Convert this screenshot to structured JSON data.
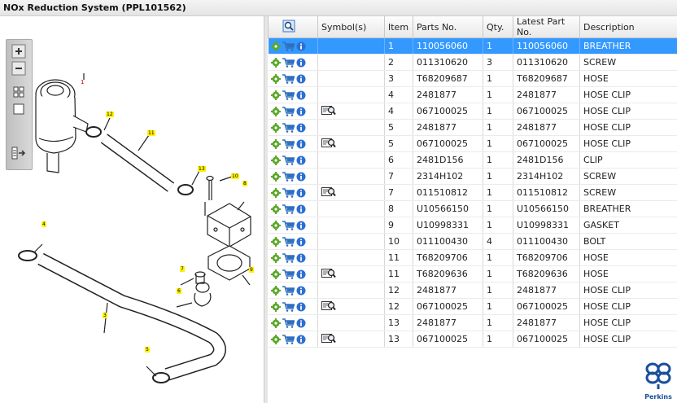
{
  "title": "NOx Reduction System (PPL101562)",
  "columns": [
    "",
    "Symbol(s)",
    "Item",
    "Parts No.",
    "Qty.",
    "Latest Part No.",
    "Description"
  ],
  "rows": [
    {
      "symbol": false,
      "item": "1",
      "part_no": "110056060",
      "qty": "1",
      "latest": "110056060",
      "desc": "BREATHER",
      "selected": true
    },
    {
      "symbol": false,
      "item": "2",
      "part_no": "011310620",
      "qty": "3",
      "latest": "011310620",
      "desc": "SCREW"
    },
    {
      "symbol": false,
      "item": "3",
      "part_no": "T68209687",
      "qty": "1",
      "latest": "T68209687",
      "desc": "HOSE"
    },
    {
      "symbol": false,
      "item": "4",
      "part_no": "2481877",
      "qty": "1",
      "latest": "2481877",
      "desc": "HOSE CLIP"
    },
    {
      "symbol": true,
      "item": "4",
      "part_no": "067100025",
      "qty": "1",
      "latest": "067100025",
      "desc": "HOSE CLIP"
    },
    {
      "symbol": false,
      "item": "5",
      "part_no": "2481877",
      "qty": "1",
      "latest": "2481877",
      "desc": "HOSE CLIP"
    },
    {
      "symbol": true,
      "item": "5",
      "part_no": "067100025",
      "qty": "1",
      "latest": "067100025",
      "desc": "HOSE CLIP"
    },
    {
      "symbol": false,
      "item": "6",
      "part_no": "2481D156",
      "qty": "1",
      "latest": "2481D156",
      "desc": "CLIP"
    },
    {
      "symbol": false,
      "item": "7",
      "part_no": "2314H102",
      "qty": "1",
      "latest": "2314H102",
      "desc": "SCREW"
    },
    {
      "symbol": true,
      "item": "7",
      "part_no": "011510812",
      "qty": "1",
      "latest": "011510812",
      "desc": "SCREW"
    },
    {
      "symbol": false,
      "item": "8",
      "part_no": "U10566150",
      "qty": "1",
      "latest": "U10566150",
      "desc": "BREATHER"
    },
    {
      "symbol": false,
      "item": "9",
      "part_no": "U10998331",
      "qty": "1",
      "latest": "U10998331",
      "desc": "GASKET"
    },
    {
      "symbol": false,
      "item": "10",
      "part_no": "011100430",
      "qty": "4",
      "latest": "011100430",
      "desc": "BOLT"
    },
    {
      "symbol": false,
      "item": "11",
      "part_no": "T68209706",
      "qty": "1",
      "latest": "T68209706",
      "desc": "HOSE"
    },
    {
      "symbol": true,
      "item": "11",
      "part_no": "T68209636",
      "qty": "1",
      "latest": "T68209636",
      "desc": "HOSE"
    },
    {
      "symbol": false,
      "item": "12",
      "part_no": "2481877",
      "qty": "1",
      "latest": "2481877",
      "desc": "HOSE CLIP"
    },
    {
      "symbol": true,
      "item": "12",
      "part_no": "067100025",
      "qty": "1",
      "latest": "067100025",
      "desc": "HOSE CLIP"
    },
    {
      "symbol": false,
      "item": "13",
      "part_no": "2481877",
      "qty": "1",
      "latest": "2481877",
      "desc": "HOSE CLIP"
    },
    {
      "symbol": true,
      "item": "13",
      "part_no": "067100025",
      "qty": "1",
      "latest": "067100025",
      "desc": "HOSE CLIP"
    }
  ],
  "callouts": [
    "1",
    "12",
    "11",
    "13",
    "10",
    "8",
    "4",
    "7",
    "9",
    "6",
    "3",
    "5"
  ],
  "brand": {
    "name": "Perkins",
    "color": "#1a4f9c"
  },
  "colors": {
    "selection": "#3399ff",
    "callout": "#fff200",
    "gear": "#5aa82a",
    "cart": "#2f6fbf",
    "info": "#2b6fd1"
  },
  "toolbar_icons": [
    "zoom-in-icon",
    "zoom-out-icon",
    "fit-grid-icon",
    "fit-window-icon",
    "sync-table-icon"
  ]
}
